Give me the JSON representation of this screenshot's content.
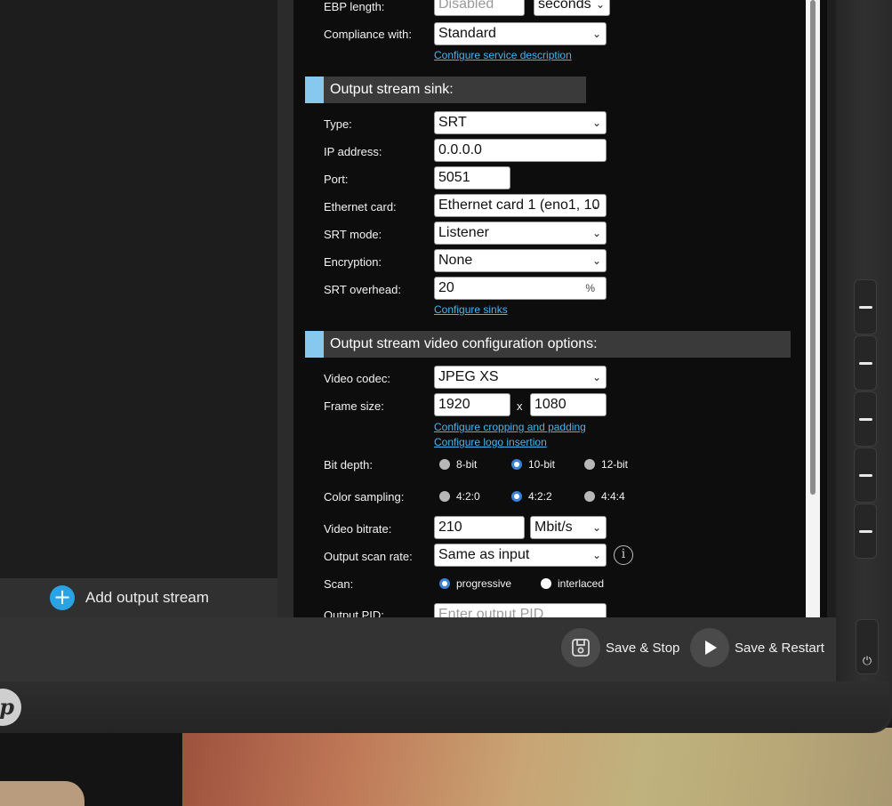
{
  "left_pane": {
    "add_output_stream": "Add output stream"
  },
  "footer": {
    "save_stop": "Save & Stop",
    "save_restart": "Save & Restart"
  },
  "form": {
    "ebp_length": {
      "label": "EBP length:",
      "placeholder": "Disabled",
      "unit": "seconds"
    },
    "compliance": {
      "label": "Compliance with:",
      "value": "Standard",
      "link": "Configure service description"
    },
    "sink_section": "Output stream sink:",
    "type": {
      "label": "Type:",
      "value": "SRT"
    },
    "ip": {
      "label": "IP address:",
      "value": "0.0.0.0"
    },
    "port": {
      "label": "Port:",
      "value": "5051"
    },
    "ethernet": {
      "label": "Ethernet card:",
      "value": "Ethernet card 1 (eno1, 10"
    },
    "srt_mode": {
      "label": "SRT mode:",
      "value": "Listener"
    },
    "encryption": {
      "label": "Encryption:",
      "value": "None"
    },
    "srt_overhead": {
      "label": "SRT overhead:",
      "value": "20",
      "unit": "%",
      "link": "Configure sinks"
    },
    "video_section": "Output stream video configuration options:",
    "codec": {
      "label": "Video codec:",
      "value": "JPEG XS"
    },
    "frame_size": {
      "label": "Frame size:",
      "width": "1920",
      "times": "x",
      "height": "1080",
      "link_crop": "Configure cropping and padding",
      "link_logo": "Configure logo insertion"
    },
    "bit_depth": {
      "label": "Bit depth:",
      "options": [
        "8-bit",
        "10-bit",
        "12-bit"
      ],
      "selected": "10-bit"
    },
    "color_sampling": {
      "label": "Color sampling:",
      "options": [
        "4:2:0",
        "4:2:2",
        "4:4:4"
      ],
      "selected": "4:2:2"
    },
    "bitrate": {
      "label": "Video bitrate:",
      "value": "210",
      "unit": "Mbit/s"
    },
    "scan_rate": {
      "label": "Output scan rate:",
      "value": "Same as input"
    },
    "scan": {
      "label": "Scan:",
      "options": [
        "progressive",
        "interlaced"
      ],
      "selected": "progressive"
    },
    "output_pid": {
      "label": "Output PID:",
      "placeholder": "Enter output PID"
    }
  },
  "colors": {
    "accent": "#86c8ee",
    "link": "#46b4f0",
    "add_icon": "#2aa3e5",
    "radio_selected": "#3b82d6"
  },
  "icons": {
    "add": "plus-icon",
    "save": "floppy-disk-icon",
    "restart": "play-icon",
    "info": "info-icon",
    "power": "power-icon",
    "logo": "hp-logo"
  }
}
